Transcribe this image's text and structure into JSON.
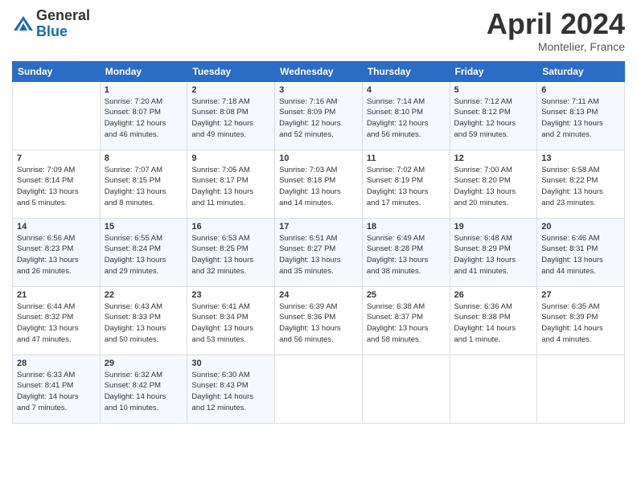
{
  "logo": {
    "general": "General",
    "blue": "Blue"
  },
  "title": "April 2024",
  "location": "Montelier, France",
  "days_header": [
    "Sunday",
    "Monday",
    "Tuesday",
    "Wednesday",
    "Thursday",
    "Friday",
    "Saturday"
  ],
  "weeks": [
    [
      {
        "day": "",
        "info": ""
      },
      {
        "day": "1",
        "info": "Sunrise: 7:20 AM\nSunset: 8:07 PM\nDaylight: 12 hours\nand 46 minutes."
      },
      {
        "day": "2",
        "info": "Sunrise: 7:18 AM\nSunset: 8:08 PM\nDaylight: 12 hours\nand 49 minutes."
      },
      {
        "day": "3",
        "info": "Sunrise: 7:16 AM\nSunset: 8:09 PM\nDaylight: 12 hours\nand 52 minutes."
      },
      {
        "day": "4",
        "info": "Sunrise: 7:14 AM\nSunset: 8:10 PM\nDaylight: 12 hours\nand 56 minutes."
      },
      {
        "day": "5",
        "info": "Sunrise: 7:12 AM\nSunset: 8:12 PM\nDaylight: 12 hours\nand 59 minutes."
      },
      {
        "day": "6",
        "info": "Sunrise: 7:11 AM\nSunset: 8:13 PM\nDaylight: 13 hours\nand 2 minutes."
      }
    ],
    [
      {
        "day": "7",
        "info": "Sunrise: 7:09 AM\nSunset: 8:14 PM\nDaylight: 13 hours\nand 5 minutes."
      },
      {
        "day": "8",
        "info": "Sunrise: 7:07 AM\nSunset: 8:15 PM\nDaylight: 13 hours\nand 8 minutes."
      },
      {
        "day": "9",
        "info": "Sunrise: 7:05 AM\nSunset: 8:17 PM\nDaylight: 13 hours\nand 11 minutes."
      },
      {
        "day": "10",
        "info": "Sunrise: 7:03 AM\nSunset: 8:18 PM\nDaylight: 13 hours\nand 14 minutes."
      },
      {
        "day": "11",
        "info": "Sunrise: 7:02 AM\nSunset: 8:19 PM\nDaylight: 13 hours\nand 17 minutes."
      },
      {
        "day": "12",
        "info": "Sunrise: 7:00 AM\nSunset: 8:20 PM\nDaylight: 13 hours\nand 20 minutes."
      },
      {
        "day": "13",
        "info": "Sunrise: 6:58 AM\nSunset: 8:22 PM\nDaylight: 13 hours\nand 23 minutes."
      }
    ],
    [
      {
        "day": "14",
        "info": "Sunrise: 6:56 AM\nSunset: 8:23 PM\nDaylight: 13 hours\nand 26 minutes."
      },
      {
        "day": "15",
        "info": "Sunrise: 6:55 AM\nSunset: 8:24 PM\nDaylight: 13 hours\nand 29 minutes."
      },
      {
        "day": "16",
        "info": "Sunrise: 6:53 AM\nSunset: 8:25 PM\nDaylight: 13 hours\nand 32 minutes."
      },
      {
        "day": "17",
        "info": "Sunrise: 6:51 AM\nSunset: 8:27 PM\nDaylight: 13 hours\nand 35 minutes."
      },
      {
        "day": "18",
        "info": "Sunrise: 6:49 AM\nSunset: 8:28 PM\nDaylight: 13 hours\nand 38 minutes."
      },
      {
        "day": "19",
        "info": "Sunrise: 6:48 AM\nSunset: 8:29 PM\nDaylight: 13 hours\nand 41 minutes."
      },
      {
        "day": "20",
        "info": "Sunrise: 6:46 AM\nSunset: 8:31 PM\nDaylight: 13 hours\nand 44 minutes."
      }
    ],
    [
      {
        "day": "21",
        "info": "Sunrise: 6:44 AM\nSunset: 8:32 PM\nDaylight: 13 hours\nand 47 minutes."
      },
      {
        "day": "22",
        "info": "Sunrise: 6:43 AM\nSunset: 8:33 PM\nDaylight: 13 hours\nand 50 minutes."
      },
      {
        "day": "23",
        "info": "Sunrise: 6:41 AM\nSunset: 8:34 PM\nDaylight: 13 hours\nand 53 minutes."
      },
      {
        "day": "24",
        "info": "Sunrise: 6:39 AM\nSunset: 8:36 PM\nDaylight: 13 hours\nand 56 minutes."
      },
      {
        "day": "25",
        "info": "Sunrise: 6:38 AM\nSunset: 8:37 PM\nDaylight: 13 hours\nand 58 minutes."
      },
      {
        "day": "26",
        "info": "Sunrise: 6:36 AM\nSunset: 8:38 PM\nDaylight: 14 hours\nand 1 minute."
      },
      {
        "day": "27",
        "info": "Sunrise: 6:35 AM\nSunset: 8:39 PM\nDaylight: 14 hours\nand 4 minutes."
      }
    ],
    [
      {
        "day": "28",
        "info": "Sunrise: 6:33 AM\nSunset: 8:41 PM\nDaylight: 14 hours\nand 7 minutes."
      },
      {
        "day": "29",
        "info": "Sunrise: 6:32 AM\nSunset: 8:42 PM\nDaylight: 14 hours\nand 10 minutes."
      },
      {
        "day": "30",
        "info": "Sunrise: 6:30 AM\nSunset: 8:43 PM\nDaylight: 14 hours\nand 12 minutes."
      },
      {
        "day": "",
        "info": ""
      },
      {
        "day": "",
        "info": ""
      },
      {
        "day": "",
        "info": ""
      },
      {
        "day": "",
        "info": ""
      }
    ]
  ]
}
